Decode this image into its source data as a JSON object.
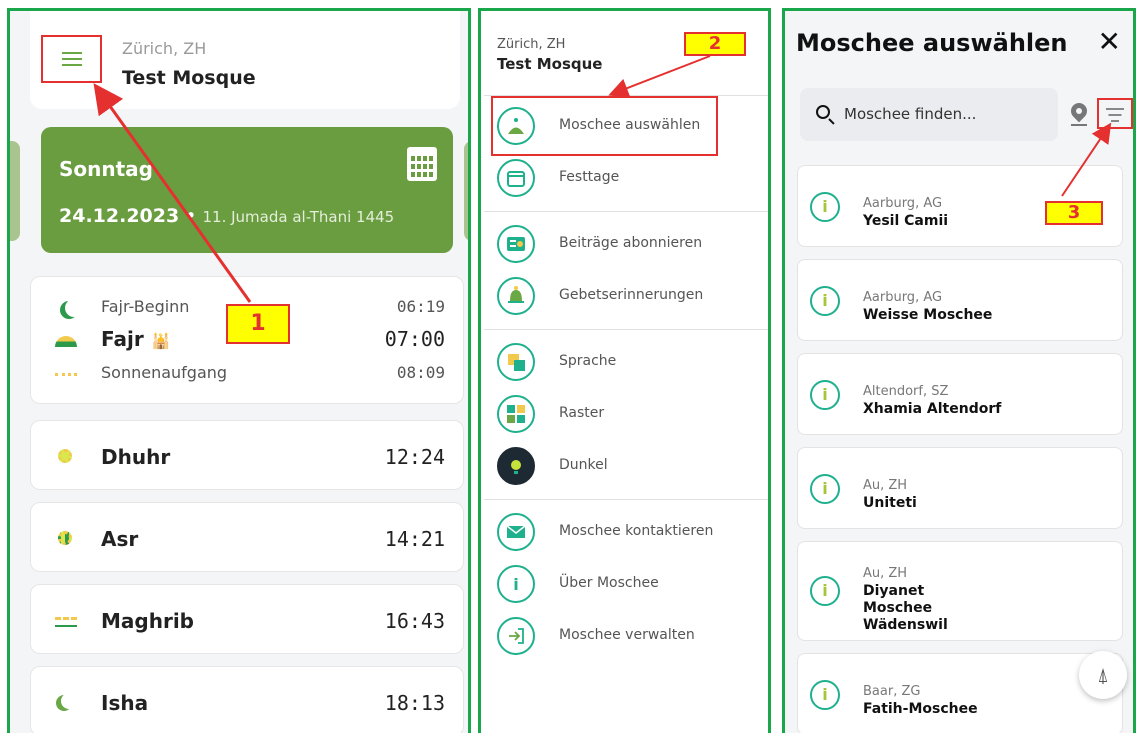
{
  "panel_left": {
    "header": {
      "city": "Zürich, ZH",
      "mosque": "Test Mosque"
    },
    "date_card": {
      "weekday": "Sonntag",
      "gregorian": "24.12.2023",
      "separator": " • ",
      "hijri": "11. Jumada al-Thani 1445"
    },
    "fajr_card": [
      {
        "name": "Fajr-Beginn",
        "time": "06:19"
      },
      {
        "name": "Fajr",
        "time": "07:00"
      },
      {
        "name": "Sonnenaufgang",
        "time": "08:09"
      }
    ],
    "prayers": [
      {
        "name": "Dhuhr",
        "time": "12:24"
      },
      {
        "name": "Asr",
        "time": "14:21"
      },
      {
        "name": "Maghrib",
        "time": "16:43"
      },
      {
        "name": "Isha",
        "time": "18:13"
      }
    ],
    "callout": "1"
  },
  "panel_middle": {
    "header": {
      "city": "Zürich, ZH",
      "mosque": "Test Mosque"
    },
    "menu": [
      {
        "label": "Moschee auswählen",
        "icon": "mosque-icon"
      },
      {
        "label": "Festtage",
        "icon": "calendar-icon"
      },
      {
        "label": "Beiträge abonnieren",
        "icon": "subscribe-icon"
      },
      {
        "label": "Gebetserinnerungen",
        "icon": "bell-icon"
      },
      {
        "label": "Sprache",
        "icon": "language-icon"
      },
      {
        "label": "Raster",
        "icon": "grid-icon"
      },
      {
        "label": "Dunkel",
        "icon": "dark-mode-icon"
      },
      {
        "label": "Moschee kontaktieren",
        "icon": "mail-icon"
      },
      {
        "label": "Über Moschee",
        "icon": "info-icon"
      },
      {
        "label": "Moschee verwalten",
        "icon": "login-icon"
      }
    ],
    "callout": "2"
  },
  "panel_right": {
    "title": "Moschee auswählen",
    "close": "✕",
    "search_placeholder": "Moschee finden...",
    "mosques": [
      {
        "location": "Aarburg, AG",
        "name": "Yesil Camii"
      },
      {
        "location": "Aarburg, AG",
        "name": "Weisse Moschee"
      },
      {
        "location": "Altendorf, SZ",
        "name": "Xhamia Altendorf"
      },
      {
        "location": "Au, ZH",
        "name": "Uniteti"
      },
      {
        "location": "Au, ZH",
        "name": "Diyanet Moschee Wädenswil"
      },
      {
        "location": "Baar, ZG",
        "name": "Fatih-Moschee"
      }
    ],
    "info_glyph": "i",
    "callout": "3"
  },
  "colors": {
    "frame": "#1aa64a",
    "date_card": "#6a9c40",
    "accent": "#1fb08e",
    "callout_fill": "#ffff00",
    "callout_border": "#e53030"
  }
}
